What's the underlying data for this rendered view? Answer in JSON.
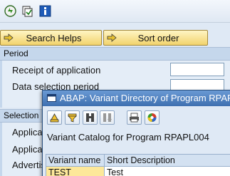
{
  "toolbar": {
    "icons": [
      "execute-icon",
      "get-variant-icon",
      "info-icon"
    ]
  },
  "buttons": {
    "search_helps": "Search Helps",
    "sort_order": "Sort order"
  },
  "period_section": {
    "title": "Period",
    "fields": [
      {
        "label": "Receipt of application",
        "value": ""
      },
      {
        "label": "Data selection period",
        "value": ""
      }
    ]
  },
  "selection_section": {
    "title": "Selection",
    "fields": [
      "Applican",
      "Applican",
      "Advertis"
    ]
  },
  "dialog": {
    "title": "ABAP: Variant Directory of Program RPAPL",
    "caption": "Variant Catalog for Program RPAPL004",
    "tools": [
      "details-icon",
      "filter-icon",
      "find-icon",
      "find-next-icon",
      "print-icon",
      "color-icon"
    ],
    "table": {
      "columns": [
        "Variant name",
        "Short Description"
      ],
      "rows": [
        {
          "variant": "TEST",
          "description": "Test"
        }
      ]
    }
  },
  "colors": {
    "accent_yellow": "#f2d36d",
    "title_blue": "#3e6fb0",
    "selected_row": "#fde89a"
  }
}
